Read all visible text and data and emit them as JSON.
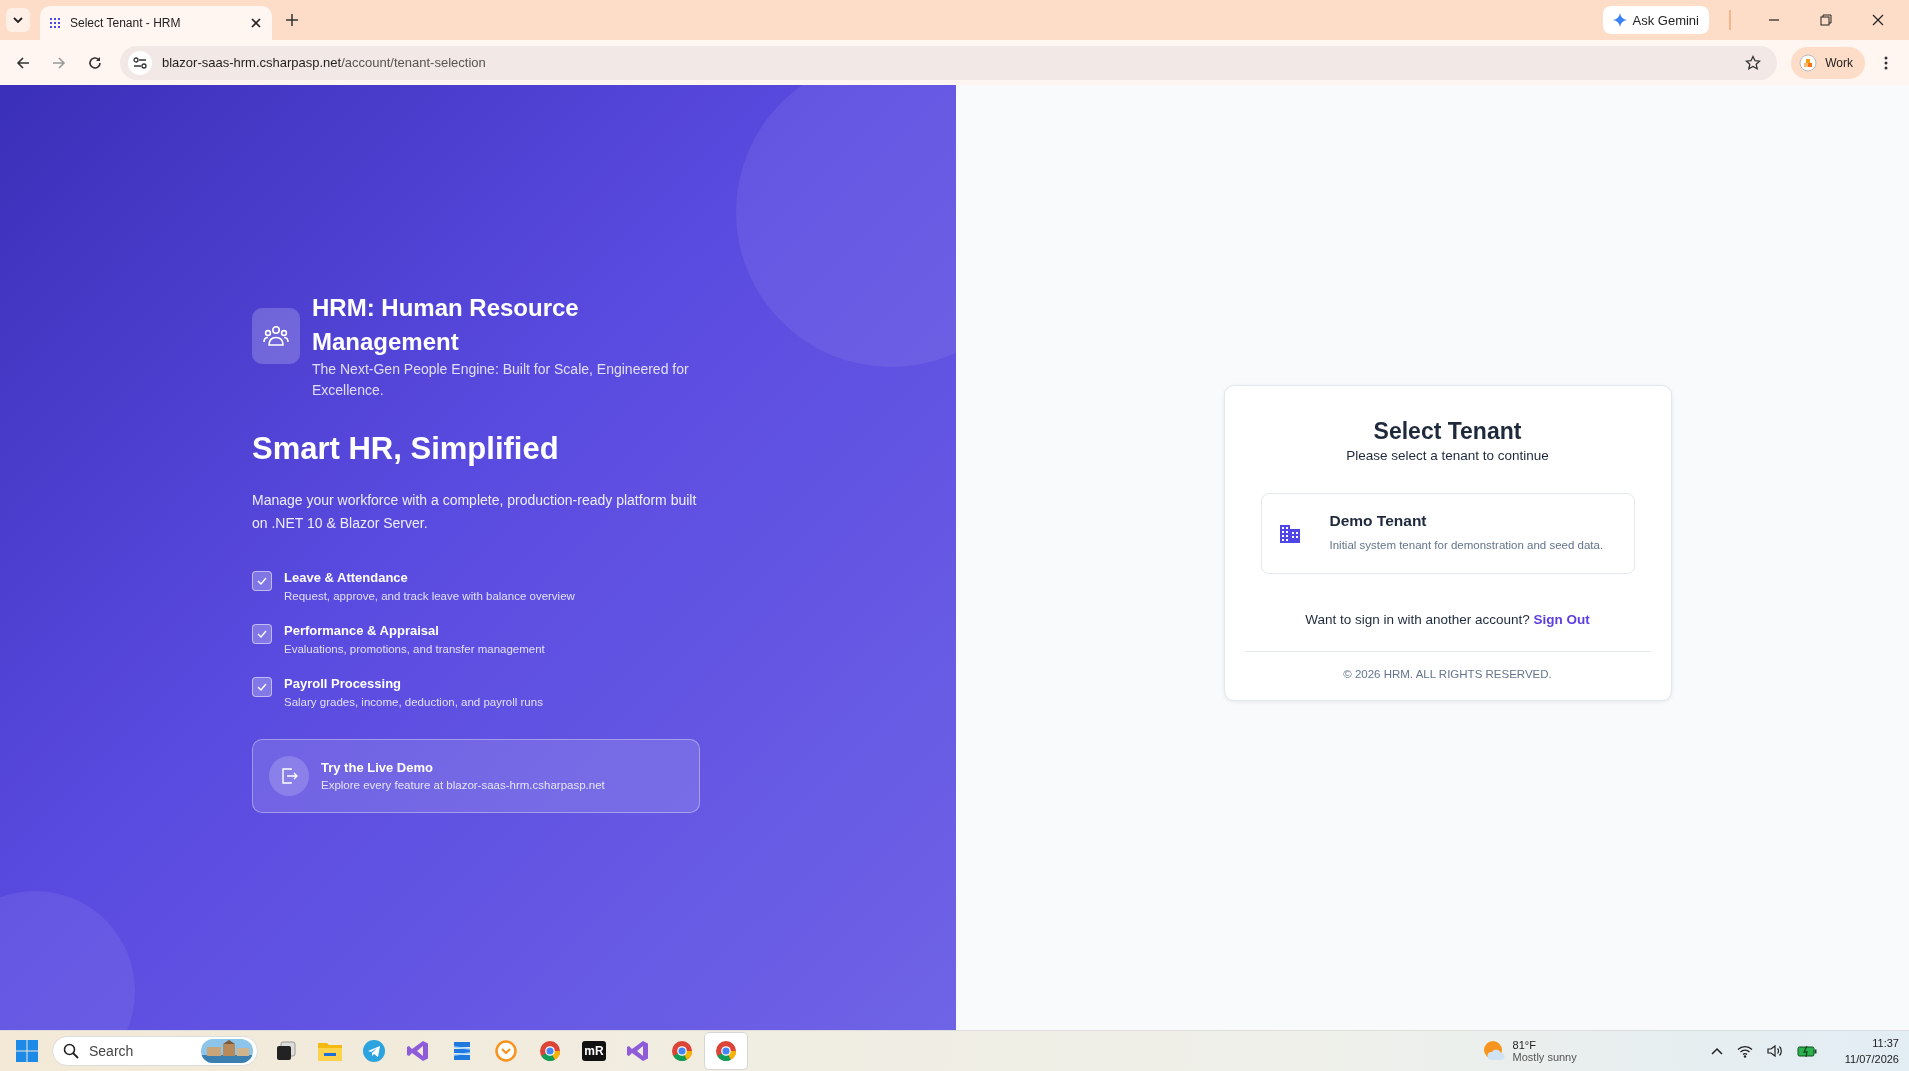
{
  "browser": {
    "tab_title": "Select Tenant - HRM",
    "url_host": "blazor-saas-hrm.csharpasp.net",
    "url_path": "/account/tenant-selection",
    "gemini_button": "Ask Gemini",
    "profile": "Work"
  },
  "brand": {
    "title": "HRM: Human Resource Management",
    "tagline": "The Next-Gen People Engine: Built for Scale, Engineered for Excellence."
  },
  "hero": {
    "heading": "Smart HR, Simplified",
    "text": "Manage your workforce with a complete, production-ready platform built on .NET 10 & Blazor Server."
  },
  "features": [
    {
      "title": "Leave & Attendance",
      "description": "Request, approve, and track leave with balance overview",
      "checked": true
    },
    {
      "title": "Performance & Appraisal",
      "description": "Evaluations, promotions, and transfer management",
      "checked": true
    },
    {
      "title": "Payroll Processing",
      "description": "Salary grades, income, deduction, and payroll runs",
      "checked": true
    }
  ],
  "demo": {
    "title": "Try the Live Demo",
    "text": "Explore every feature at blazor-saas-hrm.csharpasp.net"
  },
  "tenant_panel": {
    "title": "Select Tenant",
    "subtitle": "Please select a tenant to continue",
    "tenants": [
      {
        "name": "Demo Tenant",
        "description": "Initial system tenant for demonstration and seed data."
      }
    ],
    "prompt": "Want to sign in with another account?",
    "sign_out": "Sign Out",
    "footer": "© 2026 HRM. ALL RIGHTS RESERVED."
  },
  "taskbar": {
    "search_placeholder": "Search",
    "apps": [
      {
        "kind": "taskview",
        "selected": false
      },
      {
        "kind": "folder",
        "selected": false
      },
      {
        "kind": "plane",
        "selected": false
      },
      {
        "kind": "ribbon",
        "selected": false
      },
      {
        "kind": "stack",
        "selected": false
      },
      {
        "kind": "chevron",
        "selected": false
      },
      {
        "kind": "ring",
        "selected": false
      },
      {
        "kind": "tile",
        "label": "mR",
        "selected": false
      },
      {
        "kind": "ribbon",
        "selected": false
      },
      {
        "kind": "ring",
        "selected": false
      },
      {
        "kind": "ring",
        "selected": true
      }
    ],
    "weather": {
      "temperature": "81°F",
      "condition": "Mostly sunny"
    },
    "time": "11:37",
    "date": "11/07/2026"
  }
}
